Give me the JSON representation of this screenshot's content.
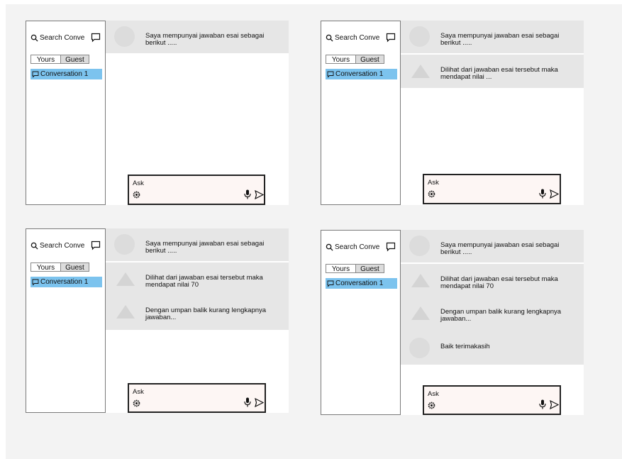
{
  "panels": [
    {
      "sidebar": {
        "search_placeholder": "Search Conve",
        "tab_yours": "Yours",
        "tab_guest": "Guest",
        "conversation": "Conversation 1"
      },
      "messages": [
        {
          "avatar": "circle",
          "text": "Saya mempunyai jawaban esai sebagai berikut ....."
        }
      ],
      "ask_label": "Ask"
    },
    {
      "sidebar": {
        "search_placeholder": "Search Conve",
        "tab_yours": "Yours",
        "tab_guest": "Guest",
        "conversation": "Conversation 1"
      },
      "messages": [
        {
          "avatar": "circle",
          "text": "Saya mempunyai jawaban esai sebagai berikut ....."
        },
        {
          "avatar": "triangle",
          "text": "Dilihat dari jawaban esai tersebut  maka mendapat nilai ..."
        }
      ],
      "ask_label": "Ask"
    },
    {
      "sidebar": {
        "search_placeholder": "Search Conve",
        "tab_yours": "Yours",
        "tab_guest": "Guest",
        "conversation": "Conversation 1"
      },
      "messages": [
        {
          "avatar": "circle",
          "text": "Saya mempunyai jawaban esai sebagai berikut ....."
        },
        {
          "avatar": "triangle",
          "text": "Dilihat dari jawaban esai tersebut  maka mendapat nilai 70"
        },
        {
          "avatar": "triangle",
          "text": "Dengan umpan balik kurang lengkapnya jawaban..."
        }
      ],
      "ask_label": "Ask"
    },
    {
      "sidebar": {
        "search_placeholder": "Search Conve",
        "tab_yours": "Yours",
        "tab_guest": "Guest",
        "conversation": "Conversation 1"
      },
      "messages": [
        {
          "avatar": "circle",
          "text": "Saya mempunyai jawaban esai sebagai berikut ....."
        },
        {
          "avatar": "triangle",
          "text": "Dilihat dari jawaban esai tersebut  maka mendapat nilai 70"
        },
        {
          "avatar": "triangle",
          "text": "Dengan umpan balik kurang lengkapnya jawaban..."
        },
        {
          "avatar": "circle",
          "text": "Baik terimakasih"
        }
      ],
      "ask_label": "Ask"
    }
  ],
  "icons": {
    "search": "search-icon",
    "new_chat": "chat-bubble-icon",
    "conversation": "chat-bubble-icon",
    "settings": "gear-icon",
    "mic": "microphone-icon",
    "send": "send-icon"
  },
  "colors": {
    "selected_conversation": "#7cc3ee",
    "message_bg": "#e6e6e6",
    "ask_bg": "#fdf6f4",
    "canvas": "#f3f3f3"
  }
}
